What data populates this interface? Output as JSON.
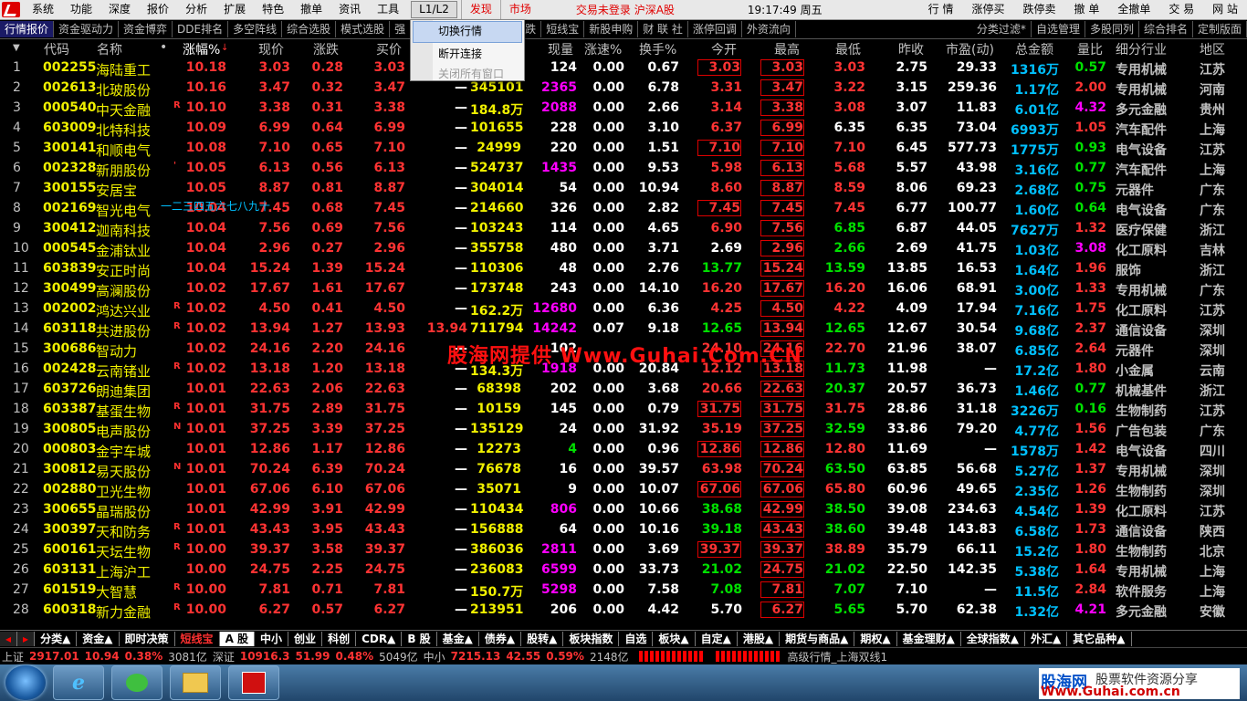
{
  "menubar": {
    "items": [
      "系统",
      "功能",
      "深度",
      "报价",
      "分析",
      "扩展",
      "特色",
      "撤单",
      "资讯",
      "工具"
    ],
    "l1l2": "L1/L2",
    "discover": "发现",
    "market": "市场",
    "login_status": "交易未登录 沪深A股",
    "clock": "19:17:49 周五",
    "right_items": [
      "行 情",
      "涨停买",
      "跌停卖",
      "撤 单",
      "全撤单",
      "交 易",
      "网 站"
    ]
  },
  "dropdown": {
    "items": [
      "切换行情",
      "断开连接",
      "关闭所有窗口"
    ]
  },
  "toolbar": {
    "items": [
      "行情报价",
      "资金驱动力",
      "资金博弈",
      "DDE排名",
      "多空阵线",
      "综合选股",
      "模式选股",
      "强",
      "涨跌",
      "短线宝",
      "新股申购",
      "财 联 社",
      "涨停回调",
      "外资流向"
    ],
    "right_items": [
      "分类过滤*",
      "自选管理",
      "多股同列",
      "综合排名",
      "定制版面"
    ]
  },
  "columns": [
    "代码",
    "名称",
    "•",
    "涨幅%",
    "现价",
    "涨跌",
    "买价",
    "卖价",
    "现量",
    "涨速%",
    "换手%",
    "今开",
    "最高",
    "最低",
    "昨收",
    "市盈(动)",
    "总金额",
    "量比",
    "细分行业",
    "地区"
  ],
  "rows": [
    {
      "n": "1",
      "code": "002255",
      "name": "海陆重工",
      "mk": "",
      "pct": "10.18",
      "price": "3.03",
      "chg": "0.28",
      "bid": "3.03",
      "ask": "—",
      "vol": "",
      "cur": "124",
      "spd": "0.00",
      "turn": "0.67",
      "open": "3.03",
      "high": "3.03",
      "low": "3.03",
      "prev": "2.75",
      "pe": "29.33",
      "amt": "1316万",
      "vr": "0.57",
      "ind": "专用机械",
      "reg": "江苏",
      "oc": "r",
      "hc": "r",
      "lc": "r",
      "curc": "w",
      "vrc": "g",
      "ob": true,
      "hb": true
    },
    {
      "n": "2",
      "code": "002613",
      "name": "北玻股份",
      "mk": "",
      "pct": "10.16",
      "price": "3.47",
      "chg": "0.32",
      "bid": "3.47",
      "ask": "—",
      "vol": "345101",
      "cur": "2365",
      "spd": "0.00",
      "turn": "6.78",
      "open": "3.31",
      "high": "3.47",
      "low": "3.22",
      "prev": "3.15",
      "pe": "259.36",
      "amt": "1.17亿",
      "vr": "2.00",
      "ind": "专用机械",
      "reg": "河南",
      "oc": "r",
      "hc": "r",
      "lc": "r",
      "curc": "m",
      "vrc": "r",
      "ob": false,
      "hb": true
    },
    {
      "n": "3",
      "code": "000540",
      "name": "中天金融",
      "mk": "R",
      "pct": "10.10",
      "price": "3.38",
      "chg": "0.31",
      "bid": "3.38",
      "ask": "—",
      "vol": "184.8万",
      "cur": "2088",
      "spd": "0.00",
      "turn": "2.66",
      "open": "3.14",
      "high": "3.38",
      "low": "3.08",
      "prev": "3.07",
      "pe": "11.83",
      "amt": "6.01亿",
      "vr": "4.32",
      "ind": "多元金融",
      "reg": "贵州",
      "oc": "r",
      "hc": "r",
      "lc": "r",
      "curc": "m",
      "vrc": "m",
      "ob": false,
      "hb": true
    },
    {
      "n": "4",
      "code": "603009",
      "name": "北特科技",
      "mk": "",
      "pct": "10.09",
      "price": "6.99",
      "chg": "0.64",
      "bid": "6.99",
      "ask": "—",
      "vol": "101655",
      "cur": "228",
      "spd": "0.00",
      "turn": "3.10",
      "open": "6.37",
      "high": "6.99",
      "low": "6.35",
      "prev": "6.35",
      "pe": "73.04",
      "amt": "6993万",
      "vr": "1.05",
      "ind": "汽车配件",
      "reg": "上海",
      "oc": "r",
      "hc": "r",
      "lc": "w",
      "curc": "w",
      "vrc": "r",
      "ob": false,
      "hb": true
    },
    {
      "n": "5",
      "code": "300141",
      "name": "和顺电气",
      "mk": "",
      "pct": "10.08",
      "price": "7.10",
      "chg": "0.65",
      "bid": "7.10",
      "ask": "—",
      "vol": "24999",
      "cur": "220",
      "spd": "0.00",
      "turn": "1.51",
      "open": "7.10",
      "high": "7.10",
      "low": "7.10",
      "prev": "6.45",
      "pe": "577.73",
      "amt": "1775万",
      "vr": "0.93",
      "ind": "电气设备",
      "reg": "江苏",
      "oc": "r",
      "hc": "r",
      "lc": "r",
      "curc": "w",
      "vrc": "g",
      "ob": true,
      "hb": true
    },
    {
      "n": "6",
      "code": "002328",
      "name": "新朋股份",
      "mk": "'",
      "pct": "10.05",
      "price": "6.13",
      "chg": "0.56",
      "bid": "6.13",
      "ask": "—",
      "vol": "524737",
      "cur": "1435",
      "spd": "0.00",
      "turn": "9.53",
      "open": "5.98",
      "high": "6.13",
      "low": "5.68",
      "prev": "5.57",
      "pe": "43.98",
      "amt": "3.16亿",
      "vr": "0.77",
      "ind": "汽车配件",
      "reg": "上海",
      "oc": "r",
      "hc": "r",
      "lc": "r",
      "curc": "m",
      "vrc": "g",
      "ob": false,
      "hb": true
    },
    {
      "n": "7",
      "code": "300155",
      "name": "安居宝",
      "mk": "",
      "pct": "10.05",
      "price": "8.87",
      "chg": "0.81",
      "bid": "8.87",
      "ask": "—",
      "vol": "304014",
      "cur": "54",
      "spd": "0.00",
      "turn": "10.94",
      "open": "8.60",
      "high": "8.87",
      "low": "8.59",
      "prev": "8.06",
      "pe": "69.23",
      "amt": "2.68亿",
      "vr": "0.75",
      "ind": "元器件",
      "reg": "广东",
      "oc": "r",
      "hc": "r",
      "lc": "r",
      "curc": "w",
      "vrc": "g",
      "ob": false,
      "hb": true
    },
    {
      "n": "8",
      "code": "002169",
      "name": "智光电气",
      "mk": "",
      "pct": "10.04",
      "price": "7.45",
      "chg": "0.68",
      "bid": "7.45",
      "ask": "—",
      "vol": "214660",
      "cur": "326",
      "spd": "0.00",
      "turn": "2.82",
      "open": "7.45",
      "high": "7.45",
      "low": "7.45",
      "prev": "6.77",
      "pe": "100.77",
      "amt": "1.60亿",
      "vr": "0.64",
      "ind": "电气设备",
      "reg": "广东",
      "oc": "r",
      "hc": "r",
      "lc": "r",
      "curc": "w",
      "vrc": "g",
      "ob": true,
      "hb": true
    },
    {
      "n": "9",
      "code": "300412",
      "name": "迦南科技",
      "mk": "",
      "pct": "10.04",
      "price": "7.56",
      "chg": "0.69",
      "bid": "7.56",
      "ask": "—",
      "vol": "103243",
      "cur": "114",
      "spd": "0.00",
      "turn": "4.65",
      "open": "6.90",
      "high": "7.56",
      "low": "6.85",
      "prev": "6.87",
      "pe": "44.05",
      "amt": "7627万",
      "vr": "1.32",
      "ind": "医疗保健",
      "reg": "浙江",
      "oc": "r",
      "hc": "r",
      "lc": "g",
      "curc": "w",
      "vrc": "r",
      "ob": false,
      "hb": true
    },
    {
      "n": "10",
      "code": "000545",
      "name": "金浦钛业",
      "mk": "",
      "pct": "10.04",
      "price": "2.96",
      "chg": "0.27",
      "bid": "2.96",
      "ask": "—",
      "vol": "355758",
      "cur": "480",
      "spd": "0.00",
      "turn": "3.71",
      "open": "2.69",
      "high": "2.96",
      "low": "2.66",
      "prev": "2.69",
      "pe": "41.75",
      "amt": "1.03亿",
      "vr": "3.08",
      "ind": "化工原料",
      "reg": "吉林",
      "oc": "w",
      "hc": "r",
      "lc": "g",
      "curc": "w",
      "vrc": "m",
      "ob": false,
      "hb": true
    },
    {
      "n": "11",
      "code": "603839",
      "name": "安正时尚",
      "mk": "",
      "pct": "10.04",
      "price": "15.24",
      "chg": "1.39",
      "bid": "15.24",
      "ask": "—",
      "vol": "110306",
      "cur": "48",
      "spd": "0.00",
      "turn": "2.76",
      "open": "13.77",
      "high": "15.24",
      "low": "13.59",
      "prev": "13.85",
      "pe": "16.53",
      "amt": "1.64亿",
      "vr": "1.96",
      "ind": "服饰",
      "reg": "浙江",
      "oc": "g",
      "hc": "r",
      "lc": "g",
      "curc": "w",
      "vrc": "r",
      "ob": false,
      "hb": true
    },
    {
      "n": "12",
      "code": "300499",
      "name": "高澜股份",
      "mk": "",
      "pct": "10.02",
      "price": "17.67",
      "chg": "1.61",
      "bid": "17.67",
      "ask": "—",
      "vol": "173748",
      "cur": "243",
      "spd": "0.00",
      "turn": "14.10",
      "open": "16.20",
      "high": "17.67",
      "low": "16.20",
      "prev": "16.06",
      "pe": "68.91",
      "amt": "3.00亿",
      "vr": "1.33",
      "ind": "专用机械",
      "reg": "广东",
      "oc": "r",
      "hc": "r",
      "lc": "r",
      "curc": "w",
      "vrc": "r",
      "ob": false,
      "hb": true
    },
    {
      "n": "13",
      "code": "002002",
      "name": "鸿达兴业",
      "mk": "R",
      "pct": "10.02",
      "price": "4.50",
      "chg": "0.41",
      "bid": "4.50",
      "ask": "—",
      "vol": "162.2万",
      "cur": "12680",
      "spd": "0.00",
      "turn": "6.36",
      "open": "4.25",
      "high": "4.50",
      "low": "4.22",
      "prev": "4.09",
      "pe": "17.94",
      "amt": "7.16亿",
      "vr": "1.75",
      "ind": "化工原料",
      "reg": "江苏",
      "oc": "r",
      "hc": "r",
      "lc": "r",
      "curc": "m",
      "vrc": "r",
      "ob": false,
      "hb": true
    },
    {
      "n": "14",
      "code": "603118",
      "name": "共进股份",
      "mk": "R",
      "pct": "10.02",
      "price": "13.94",
      "chg": "1.27",
      "bid": "13.93",
      "ask": "13.94",
      "vol": "711794",
      "cur": "14242",
      "spd": "0.07",
      "turn": "9.18",
      "open": "12.65",
      "high": "13.94",
      "low": "12.65",
      "prev": "12.67",
      "pe": "30.54",
      "amt": "9.68亿",
      "vr": "2.37",
      "ind": "通信设备",
      "reg": "深圳",
      "oc": "g",
      "hc": "r",
      "lc": "g",
      "curc": "m",
      "vrc": "r",
      "ob": false,
      "hb": true
    },
    {
      "n": "15",
      "code": "300686",
      "name": "智动力",
      "mk": "",
      "pct": "10.02",
      "price": "24.16",
      "chg": "2.20",
      "bid": "24.16",
      "ask": "—",
      "vol": "",
      "cur": "102",
      "spd": "",
      "turn": "",
      "open": "24.10",
      "high": "24.16",
      "low": "22.70",
      "prev": "21.96",
      "pe": "38.07",
      "amt": "6.85亿",
      "vr": "2.64",
      "ind": "元器件",
      "reg": "深圳",
      "oc": "r",
      "hc": "r",
      "lc": "r",
      "curc": "w",
      "vrc": "r",
      "ob": false,
      "hb": true
    },
    {
      "n": "16",
      "code": "002428",
      "name": "云南锗业",
      "mk": "R",
      "pct": "10.02",
      "price": "13.18",
      "chg": "1.20",
      "bid": "13.18",
      "ask": "—",
      "vol": "134.3万",
      "cur": "1918",
      "spd": "0.00",
      "turn": "20.84",
      "open": "12.12",
      "high": "13.18",
      "low": "11.73",
      "prev": "11.98",
      "pe": "—",
      "amt": "17.2亿",
      "vr": "1.80",
      "ind": "小金属",
      "reg": "云南",
      "oc": "r",
      "hc": "r",
      "lc": "g",
      "curc": "m",
      "vrc": "r",
      "ob": false,
      "hb": true
    },
    {
      "n": "17",
      "code": "603726",
      "name": "朗迪集团",
      "mk": "",
      "pct": "10.01",
      "price": "22.63",
      "chg": "2.06",
      "bid": "22.63",
      "ask": "—",
      "vol": "68398",
      "cur": "202",
      "spd": "0.00",
      "turn": "3.68",
      "open": "20.66",
      "high": "22.63",
      "low": "20.37",
      "prev": "20.57",
      "pe": "36.73",
      "amt": "1.46亿",
      "vr": "0.77",
      "ind": "机械基件",
      "reg": "浙江",
      "oc": "r",
      "hc": "r",
      "lc": "g",
      "curc": "w",
      "vrc": "g",
      "ob": false,
      "hb": true
    },
    {
      "n": "18",
      "code": "603387",
      "name": "基蛋生物",
      "mk": "R",
      "pct": "10.01",
      "price": "31.75",
      "chg": "2.89",
      "bid": "31.75",
      "ask": "—",
      "vol": "10159",
      "cur": "145",
      "spd": "0.00",
      "turn": "0.79",
      "open": "31.75",
      "high": "31.75",
      "low": "31.75",
      "prev": "28.86",
      "pe": "31.18",
      "amt": "3226万",
      "vr": "0.16",
      "ind": "生物制药",
      "reg": "江苏",
      "oc": "r",
      "hc": "r",
      "lc": "r",
      "curc": "w",
      "vrc": "g",
      "ob": true,
      "hb": true
    },
    {
      "n": "19",
      "code": "300805",
      "name": "电声股份",
      "mk": "N",
      "pct": "10.01",
      "price": "37.25",
      "chg": "3.39",
      "bid": "37.25",
      "ask": "—",
      "vol": "135129",
      "cur": "24",
      "spd": "0.00",
      "turn": "31.92",
      "open": "35.19",
      "high": "37.25",
      "low": "32.59",
      "prev": "33.86",
      "pe": "79.20",
      "amt": "4.77亿",
      "vr": "1.56",
      "ind": "广告包装",
      "reg": "广东",
      "oc": "r",
      "hc": "r",
      "lc": "g",
      "curc": "w",
      "vrc": "r",
      "ob": false,
      "hb": true
    },
    {
      "n": "20",
      "code": "000803",
      "name": "金宇车城",
      "mk": "",
      "pct": "10.01",
      "price": "12.86",
      "chg": "1.17",
      "bid": "12.86",
      "ask": "—",
      "vol": "12273",
      "cur": "4",
      "spd": "0.00",
      "turn": "0.96",
      "open": "12.86",
      "high": "12.86",
      "low": "12.80",
      "prev": "11.69",
      "pe": "—",
      "amt": "1578万",
      "vr": "1.42",
      "ind": "电气设备",
      "reg": "四川",
      "oc": "r",
      "hc": "r",
      "lc": "r",
      "curc": "g",
      "vrc": "r",
      "ob": true,
      "hb": true
    },
    {
      "n": "21",
      "code": "300812",
      "name": "易天股份",
      "mk": "N",
      "pct": "10.01",
      "price": "70.24",
      "chg": "6.39",
      "bid": "70.24",
      "ask": "—",
      "vol": "76678",
      "cur": "16",
      "spd": "0.00",
      "turn": "39.57",
      "open": "63.98",
      "high": "70.24",
      "low": "63.50",
      "prev": "63.85",
      "pe": "56.68",
      "amt": "5.27亿",
      "vr": "1.37",
      "ind": "专用机械",
      "reg": "深圳",
      "oc": "r",
      "hc": "r",
      "lc": "g",
      "curc": "w",
      "vrc": "r",
      "ob": false,
      "hb": true
    },
    {
      "n": "22",
      "code": "002880",
      "name": "卫光生物",
      "mk": "",
      "pct": "10.01",
      "price": "67.06",
      "chg": "6.10",
      "bid": "67.06",
      "ask": "—",
      "vol": "35071",
      "cur": "9",
      "spd": "0.00",
      "turn": "10.07",
      "open": "67.06",
      "high": "67.06",
      "low": "65.80",
      "prev": "60.96",
      "pe": "49.65",
      "amt": "2.35亿",
      "vr": "1.26",
      "ind": "生物制药",
      "reg": "深圳",
      "oc": "r",
      "hc": "r",
      "lc": "r",
      "curc": "w",
      "vrc": "r",
      "ob": true,
      "hb": true
    },
    {
      "n": "23",
      "code": "300655",
      "name": "晶瑞股份",
      "mk": "",
      "pct": "10.01",
      "price": "42.99",
      "chg": "3.91",
      "bid": "42.99",
      "ask": "—",
      "vol": "110434",
      "cur": "806",
      "spd": "0.00",
      "turn": "10.66",
      "open": "38.68",
      "high": "42.99",
      "low": "38.50",
      "prev": "39.08",
      "pe": "234.63",
      "amt": "4.54亿",
      "vr": "1.39",
      "ind": "化工原料",
      "reg": "江苏",
      "oc": "g",
      "hc": "r",
      "lc": "g",
      "curc": "m",
      "vrc": "r",
      "ob": false,
      "hb": true
    },
    {
      "n": "24",
      "code": "300397",
      "name": "天和防务",
      "mk": "R",
      "pct": "10.01",
      "price": "43.43",
      "chg": "3.95",
      "bid": "43.43",
      "ask": "—",
      "vol": "156888",
      "cur": "64",
      "spd": "0.00",
      "turn": "10.16",
      "open": "39.18",
      "high": "43.43",
      "low": "38.60",
      "prev": "39.48",
      "pe": "143.83",
      "amt": "6.58亿",
      "vr": "1.73",
      "ind": "通信设备",
      "reg": "陕西",
      "oc": "g",
      "hc": "r",
      "lc": "g",
      "curc": "w",
      "vrc": "r",
      "ob": false,
      "hb": true
    },
    {
      "n": "25",
      "code": "600161",
      "name": "天坛生物",
      "mk": "R",
      "pct": "10.00",
      "price": "39.37",
      "chg": "3.58",
      "bid": "39.37",
      "ask": "—",
      "vol": "386036",
      "cur": "2811",
      "spd": "0.00",
      "turn": "3.69",
      "open": "39.37",
      "high": "39.37",
      "low": "38.89",
      "prev": "35.79",
      "pe": "66.11",
      "amt": "15.2亿",
      "vr": "1.80",
      "ind": "生物制药",
      "reg": "北京",
      "oc": "r",
      "hc": "r",
      "lc": "r",
      "curc": "m",
      "vrc": "r",
      "ob": true,
      "hb": true
    },
    {
      "n": "26",
      "code": "603131",
      "name": "上海沪工",
      "mk": "",
      "pct": "10.00",
      "price": "24.75",
      "chg": "2.25",
      "bid": "24.75",
      "ask": "—",
      "vol": "236083",
      "cur": "6599",
      "spd": "0.00",
      "turn": "33.73",
      "open": "21.02",
      "high": "24.75",
      "low": "21.02",
      "prev": "22.50",
      "pe": "142.35",
      "amt": "5.38亿",
      "vr": "1.64",
      "ind": "专用机械",
      "reg": "上海",
      "oc": "g",
      "hc": "r",
      "lc": "g",
      "curc": "m",
      "vrc": "r",
      "ob": false,
      "hb": true
    },
    {
      "n": "27",
      "code": "601519",
      "name": "大智慧",
      "mk": "R",
      "pct": "10.00",
      "price": "7.81",
      "chg": "0.71",
      "bid": "7.81",
      "ask": "—",
      "vol": "150.7万",
      "cur": "5298",
      "spd": "0.00",
      "turn": "7.58",
      "open": "7.08",
      "high": "7.81",
      "low": "7.07",
      "prev": "7.10",
      "pe": "—",
      "amt": "11.5亿",
      "vr": "2.84",
      "ind": "软件服务",
      "reg": "上海",
      "oc": "g",
      "hc": "r",
      "lc": "g",
      "curc": "m",
      "vrc": "r",
      "ob": false,
      "hb": true
    },
    {
      "n": "28",
      "code": "600318",
      "name": "新力金融",
      "mk": "R",
      "pct": "10.00",
      "price": "6.27",
      "chg": "0.57",
      "bid": "6.27",
      "ask": "—",
      "vol": "213951",
      "cur": "206",
      "spd": "0.00",
      "turn": "4.42",
      "open": "5.70",
      "high": "6.27",
      "low": "5.65",
      "prev": "5.70",
      "pe": "62.38",
      "amt": "1.32亿",
      "vr": "4.21",
      "ind": "多元金融",
      "reg": "安徽",
      "oc": "w",
      "hc": "r",
      "lc": "g",
      "curc": "w",
      "vrc": "m",
      "ob": false,
      "hb": true
    }
  ],
  "tooltip_text": "一二三四五六七八九十",
  "watermark": "股海网提供 Www.Guhai.Com.CN",
  "tabs": [
    "分类▲",
    "资金▲",
    "即时决策",
    "短线宝",
    "A 股",
    "中小",
    "创业",
    "科创",
    "CDR▲",
    "B 股",
    "基金▲",
    "债券▲",
    "股转▲",
    "板块指数",
    "自选",
    "板块▲",
    "自定▲",
    "港股▲",
    "期货与商品▲",
    "期权▲",
    "基金理财▲",
    "全球指数▲",
    "外汇▲",
    "其它品种▲"
  ],
  "statusbar": {
    "sh_label": "上证",
    "sh_val": "2917.01",
    "sh_chg": "10.94",
    "sh_pct": "0.38%",
    "sh_amt": "3081亿",
    "sz_label": "深证",
    "sz_val": "10916.3",
    "sz_chg": "51.99",
    "sz_pct": "0.48%",
    "sz_amt": "5049亿",
    "zx_label": "中小",
    "zx_val": "7215.13",
    "zx_chg": "42.55",
    "zx_pct": "0.59%",
    "zx_amt": "2148亿",
    "feed": "高级行情_上海双线1"
  },
  "brand": {
    "name": "股海网",
    "slogan": "股票软件资源分享",
    "url": "Www.Guhai.com.cn"
  }
}
